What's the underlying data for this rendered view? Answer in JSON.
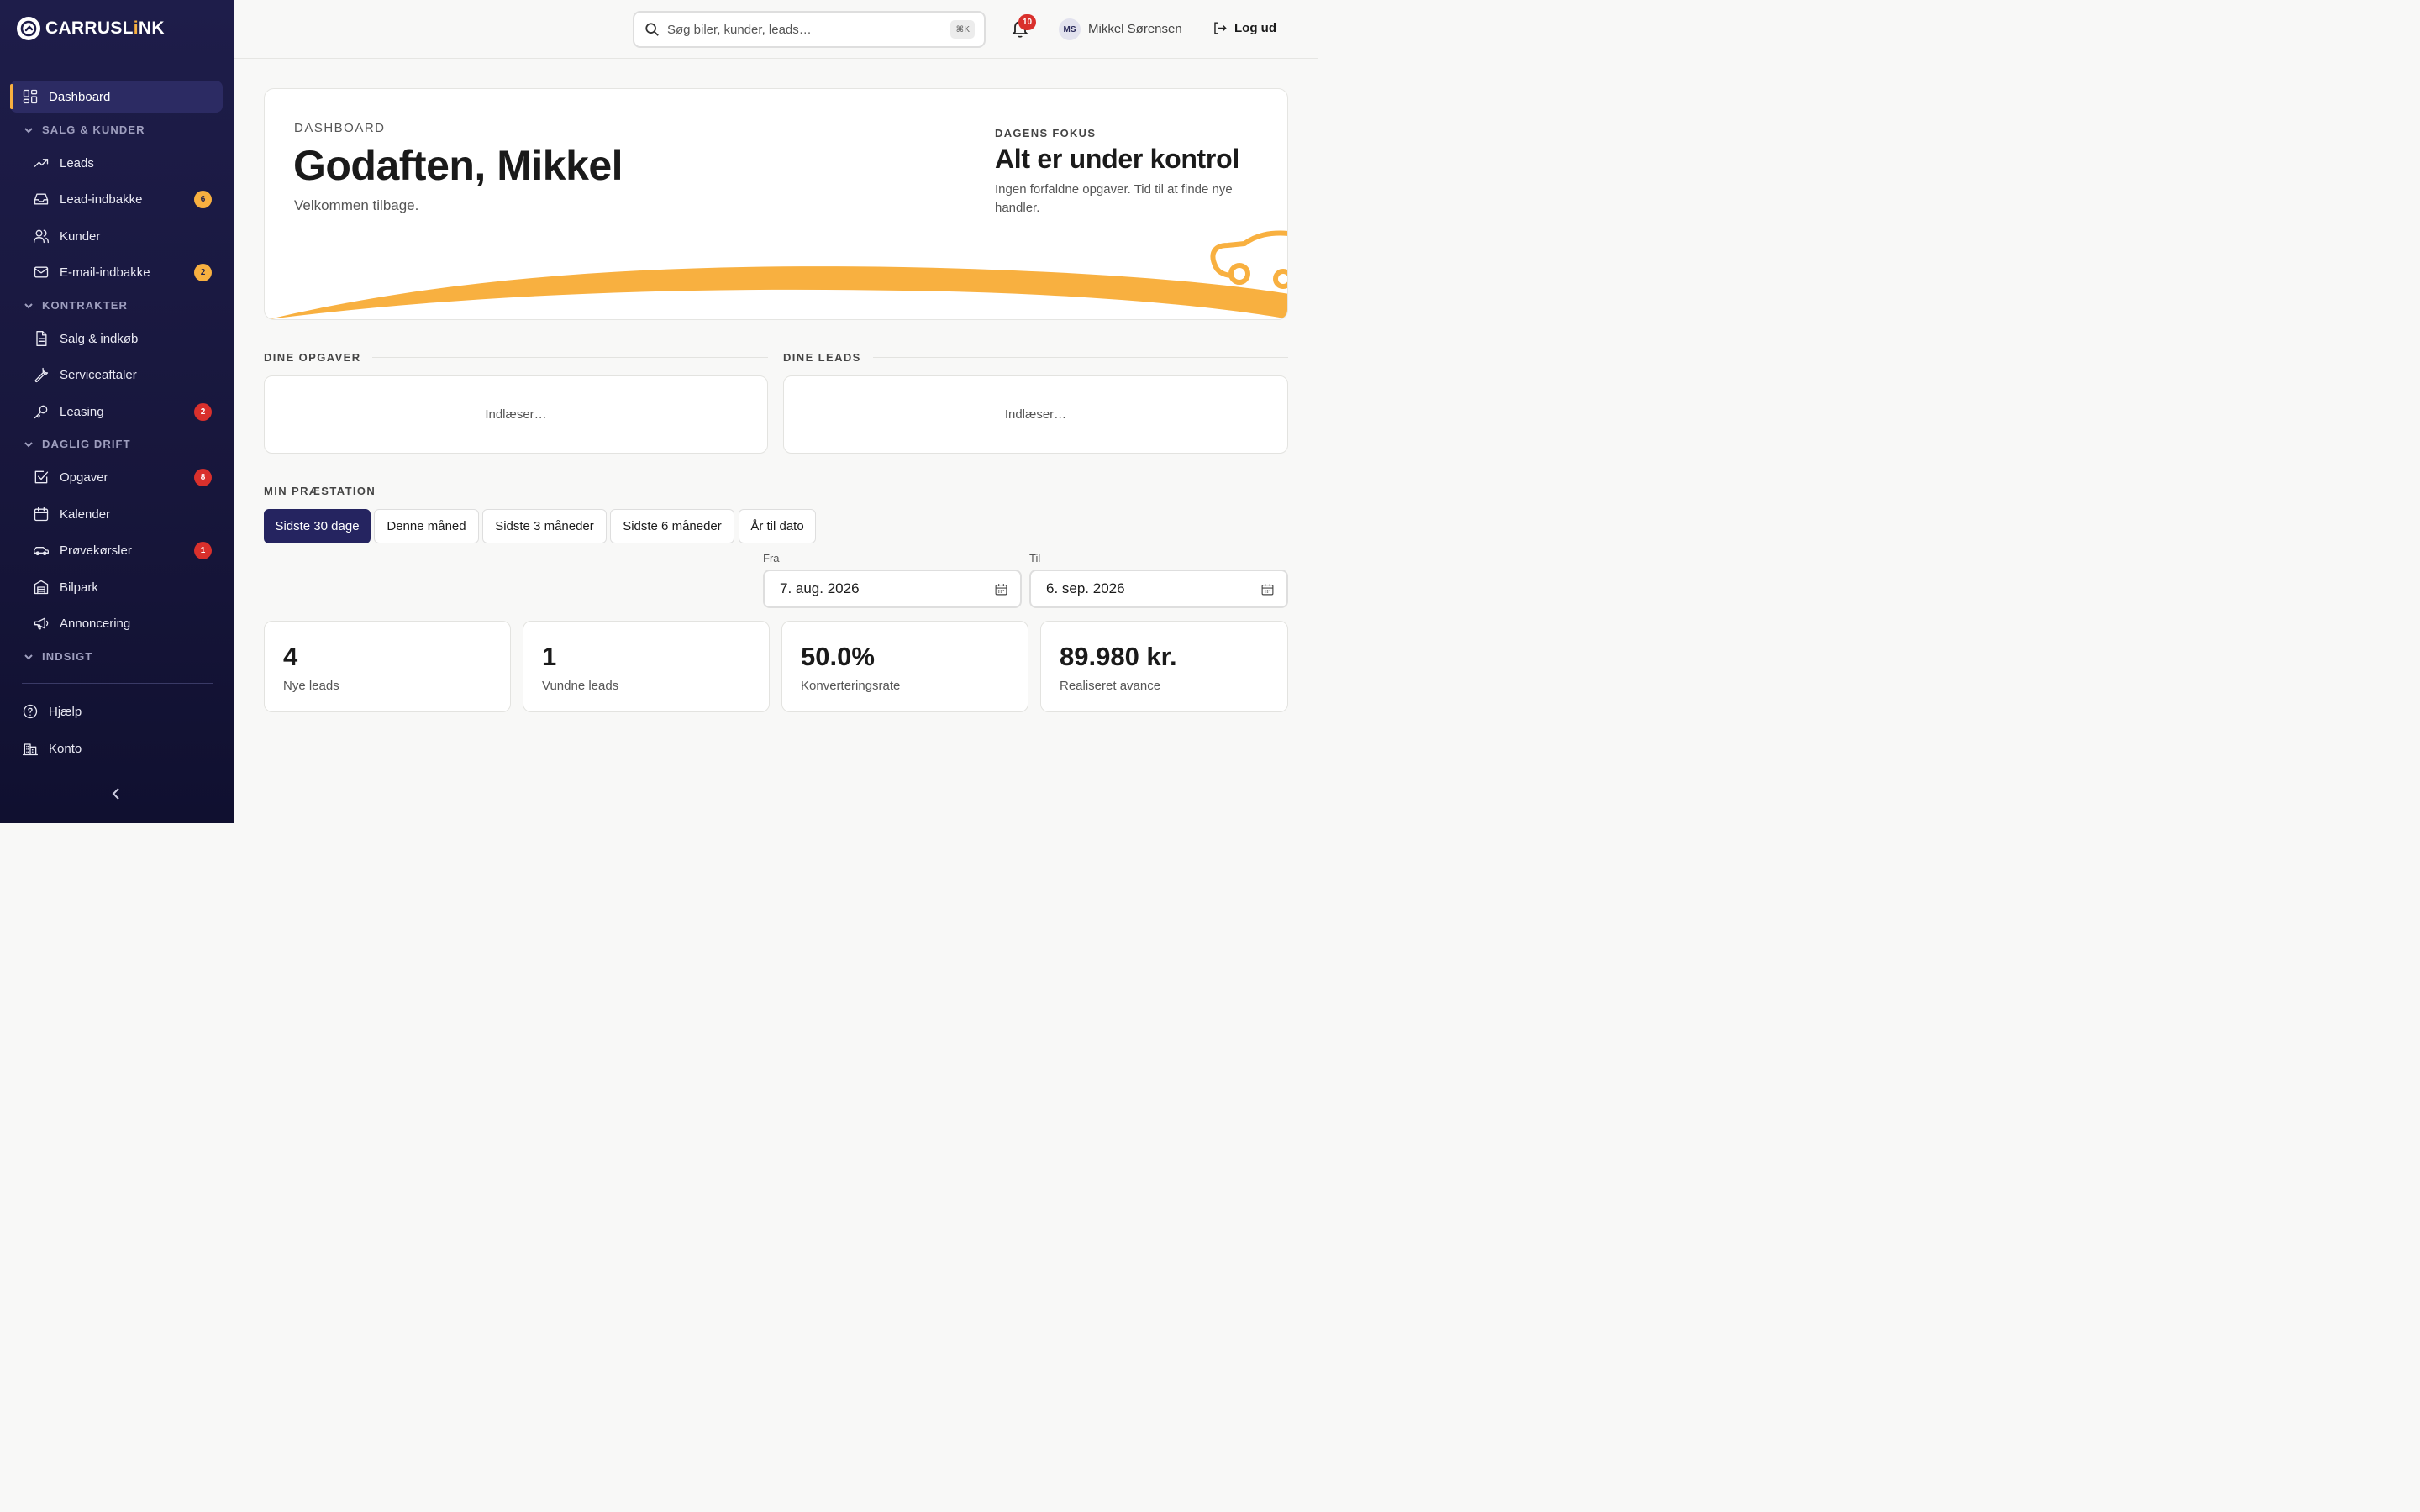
{
  "brand": {
    "name_a": "CARRUSL",
    "name_i": "i",
    "name_b": "NK",
    "accent": "#f8b040",
    "sidebar_bg": "#1e1d4a"
  },
  "sidebar": {
    "dashboard": "Dashboard",
    "sections": {
      "salg": "SALG & KUNDER",
      "kontrakter": "KONTRAKTER",
      "drift": "DAGLIG DRIFT",
      "indsigt": "INDSIGT"
    },
    "items": {
      "leads": {
        "label": "Leads"
      },
      "lead_indbakke": {
        "label": "Lead-indbakke",
        "badge": "6"
      },
      "kunder": {
        "label": "Kunder"
      },
      "email": {
        "label": "E-mail-indbakke",
        "badge": "2"
      },
      "salg_indkob": {
        "label": "Salg & indkøb"
      },
      "service": {
        "label": "Serviceaftaler"
      },
      "leasing": {
        "label": "Leasing",
        "badge": "2"
      },
      "opgaver": {
        "label": "Opgaver",
        "badge": "8"
      },
      "kalender": {
        "label": "Kalender"
      },
      "provekorsler": {
        "label": "Prøvekørsler",
        "badge": "1"
      },
      "bilpark": {
        "label": "Bilpark"
      },
      "annoncering": {
        "label": "Annoncering"
      }
    },
    "footer": {
      "help": "Hjælp",
      "account": "Konto"
    }
  },
  "topbar": {
    "search_placeholder": "Søg biler, kunder, leads…",
    "shortcut": "⌘K",
    "notifications": "10",
    "avatar_initials": "MS",
    "user_name": "Mikkel Sørensen",
    "logout": "Log ud"
  },
  "hero": {
    "eyebrow": "DASHBOARD",
    "greeting": "Godaften, Mikkel",
    "subtitle": "Velkommen tilbage.",
    "focus_label": "DAGENS FOKUS",
    "focus_title": "Alt er under kontrol",
    "focus_text": "Ingen forfaldne opgaver. Tid til at finde nye handler."
  },
  "tasks": {
    "title": "DINE OPGAVER",
    "loading": "Indlæser…"
  },
  "leads": {
    "title": "DINE LEADS",
    "loading": "Indlæser…"
  },
  "performance": {
    "title": "MIN PRÆSTATION",
    "periods": [
      "Sidste 30 dage",
      "Denne måned",
      "Sidste 3 måneder",
      "Sidste 6 måneder",
      "År til dato"
    ],
    "active_period": "Sidste 30 dage",
    "from_label": "Fra",
    "from_value": "7. aug. 2026",
    "to_label": "Til",
    "to_value": "6. sep. 2026",
    "kpis": [
      {
        "value": "4",
        "label": "Nye leads"
      },
      {
        "value": "1",
        "label": "Vundne leads"
      },
      {
        "value": "50.0%",
        "label": "Konverteringsrate"
      },
      {
        "value": "89.980 kr.",
        "label": "Realiseret avance"
      }
    ]
  }
}
